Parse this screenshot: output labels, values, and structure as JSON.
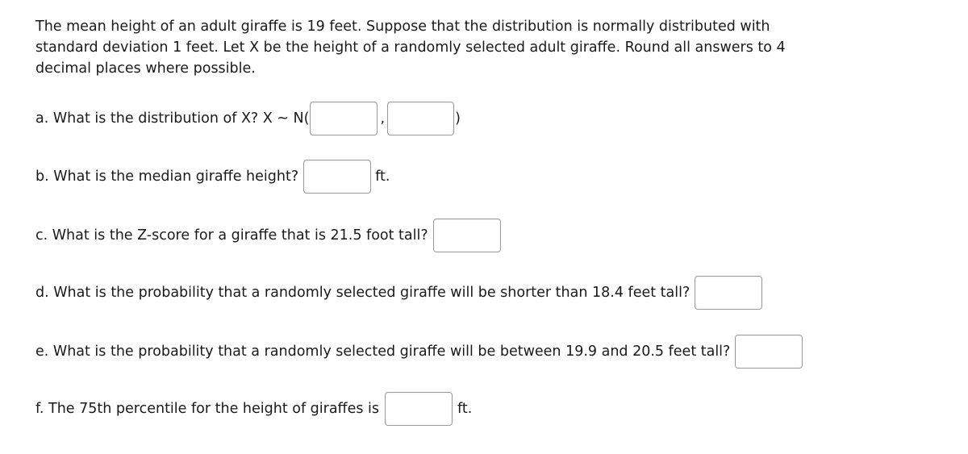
{
  "intro": {
    "line1": "The mean height of an adult giraffe is 19 feet. Suppose that the distribution is normally distributed with",
    "line2": "standard deviation 1 feet. Let X be the height of a randomly selected adult giraffe. Round all answers to 4",
    "line3": "decimal places where possible."
  },
  "questions": {
    "a": {
      "prompt": "a. What is the distribution of X? X ~ N(",
      "separator": ",",
      "close": ")",
      "mean_value": "",
      "sd_value": ""
    },
    "b": {
      "prompt": "b. What is the median giraffe height?",
      "unit": "ft.",
      "value": ""
    },
    "c": {
      "prompt": "c. What is the Z-score for a giraffe that is 21.5 foot tall?",
      "value": ""
    },
    "d": {
      "prompt": "d. What is the probability that a randomly selected giraffe will be shorter than 18.4 feet tall?",
      "value": ""
    },
    "e": {
      "prompt": "e. What is the probability that a randomly selected giraffe will be between 19.9 and 20.5 feet tall?",
      "value": ""
    },
    "f": {
      "prompt": "f. The 75th percentile for the height of giraffes is",
      "unit": "ft.",
      "value": ""
    }
  }
}
